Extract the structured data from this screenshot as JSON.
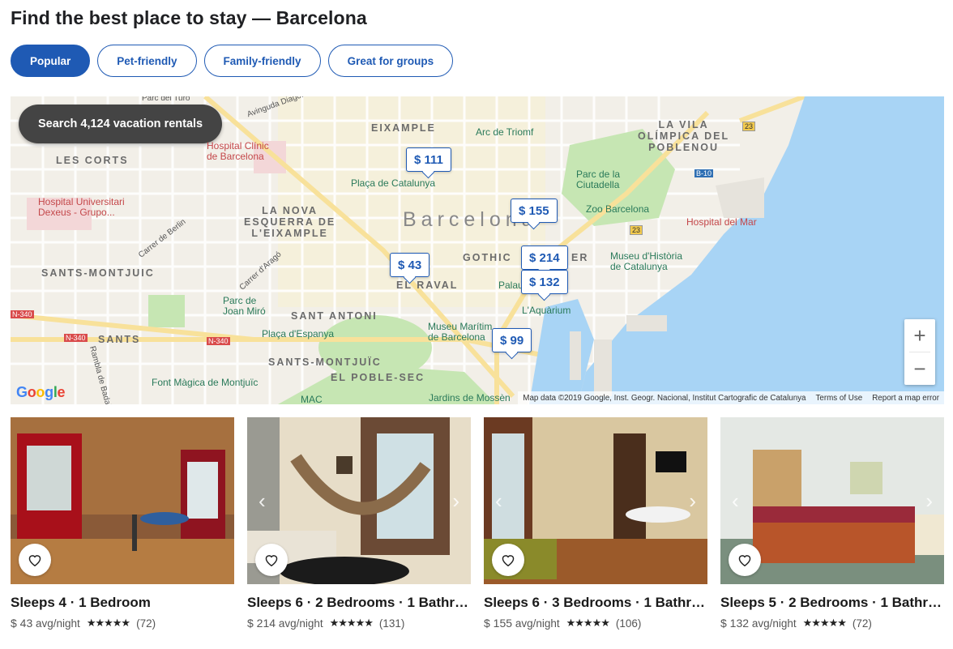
{
  "page": {
    "title": "Find the best place to stay — Barcelona"
  },
  "filters": [
    {
      "label": "Popular",
      "active": true
    },
    {
      "label": "Pet-friendly",
      "active": false
    },
    {
      "label": "Family-friendly",
      "active": false
    },
    {
      "label": "Great for groups",
      "active": false
    }
  ],
  "map": {
    "search_button": "Search 4,124 vacation rentals",
    "city_label": "Barcelona",
    "districts": {
      "eixample": "EIXAMPLE",
      "vila_olimpica": "LA VILA\nOLÍMPICA DEL\nPOBLENOU",
      "les_corts": "LES CORTS",
      "nova_esquerra": "LA NOVA\nESQUERRA DE\nL'EIXAMPLE",
      "sants_montjuic_w": "SANTS-MONTJUIC",
      "gothic": "GOTHIC",
      "gothic_q": "ER",
      "raval": "EL RAVAL",
      "sant_antoni": "SANT ANTONI",
      "sants": "SANTS",
      "sants_montjuic_s": "SANTS-MONTJUÏC",
      "poble_sec": "EL POBLE-SEC"
    },
    "pois": {
      "arc_triomf": "Arc de Triomf",
      "hospital_clinic": "Hospital Clínic\nde Barcelona",
      "placa_catalunya": "Plaça de Catalunya",
      "parc_ciutadella": "Parc de la\nCiutadella",
      "zoo": "Zoo Barcelona",
      "hospital_mar": "Hospital del Mar",
      "hospital_dexeus": "Hospital Universitari\nDexeus - Grupo...",
      "museu_historia": "Museu d'Història\nde Catalunya",
      "palau": "Palau",
      "aquarium": "L'Aquàrium",
      "parc_miro": "Parc de\nJoan Miró",
      "placa_espanya": "Plaça d'Espanya",
      "museu_maritim": "Museu Marítim\nde Barcelona",
      "font_magica": "Font Màgica de Montjuïc",
      "mac": "MAC",
      "jardins": "Jardins de Mossèn",
      "parc_turo": "Parc del Turó"
    },
    "streets": {
      "diagonal": "Avinguda Diago...",
      "berlin": "Carrer de Berlin",
      "arago": "Carrer d'Aragó",
      "rambla": "Rambla de Badal"
    },
    "road_badges": [
      "23",
      "B-10",
      "23",
      "N-340",
      "N-340",
      "N-340"
    ],
    "price_pins": [
      "$ 111",
      "$ 155",
      "$ 43",
      "$ 214",
      "$ 132",
      "$ 99"
    ],
    "zoom_in": "+",
    "zoom_out": "−",
    "google_logo": "Google",
    "attribution": "Map data ©2019 Google, Inst. Geogr. Nacional, Institut Cartografic de Catalunya",
    "terms": "Terms of Use",
    "report": "Report a map error",
    "colors": {
      "water": "#a8d4f5",
      "park": "#c6e6b3",
      "land": "#f2efe8",
      "road": "#ffffff",
      "major_road": "#f8e19a"
    }
  },
  "listings": [
    {
      "title": "Sleeps 4 · 1 Bedroom",
      "price": "$ 43",
      "unit": "avg/night",
      "stars": "★★★★★",
      "rating": 4.5,
      "reviews": "(72)"
    },
    {
      "title": "Sleeps 6 · 2 Bedrooms · 1 Bathro...",
      "price": "$ 214",
      "unit": "avg/night",
      "stars": "★★★★★",
      "rating": 4.5,
      "reviews": "(131)"
    },
    {
      "title": "Sleeps 6 · 3 Bedrooms · 1 Bathro...",
      "price": "$ 155",
      "unit": "avg/night",
      "stars": "★★★★★",
      "rating": 4.5,
      "reviews": "(106)"
    },
    {
      "title": "Sleeps 5 · 2 Bedrooms · 1 Bathro...",
      "price": "$ 132",
      "unit": "avg/night",
      "stars": "★★★★★",
      "rating": 4.5,
      "reviews": "(72)"
    }
  ],
  "icons": {
    "heart": "heart-icon",
    "prev": "chevron-left-icon",
    "next": "chevron-right-icon"
  }
}
